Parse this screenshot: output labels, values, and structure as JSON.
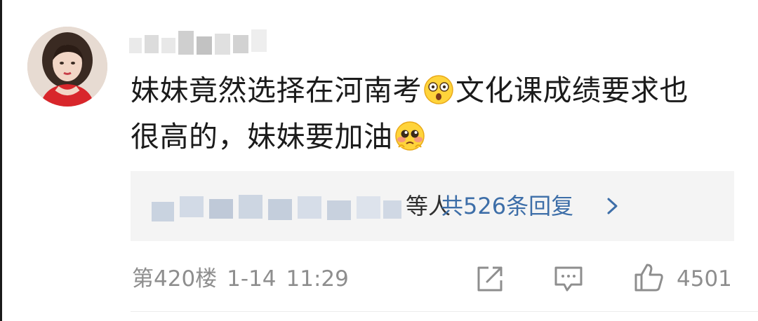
{
  "comment": {
    "line1_part1": "妹妹竟然选择在河南考",
    "line1_part2": "文化课成绩要求也",
    "line2_part1": "很高的，妹妹要加油",
    "emoji_1": "shocked-face-icon",
    "emoji_2": "pleading-face-icon"
  },
  "replies": {
    "suffix": "等人",
    "count_label": "共526条回复",
    "arrow_icon": "chevron-right-icon"
  },
  "meta": {
    "floor": "第420楼",
    "date": "1-14",
    "time": "11:29"
  },
  "actions": {
    "share_icon": "share-icon",
    "comment_icon": "comment-icon",
    "like_icon": "thumbs-up-icon",
    "like_count": "4501"
  },
  "colors": {
    "link_blue": "#3d6ea8",
    "meta_gray": "#8e8e8e",
    "reply_bg": "#f4f4f4"
  }
}
